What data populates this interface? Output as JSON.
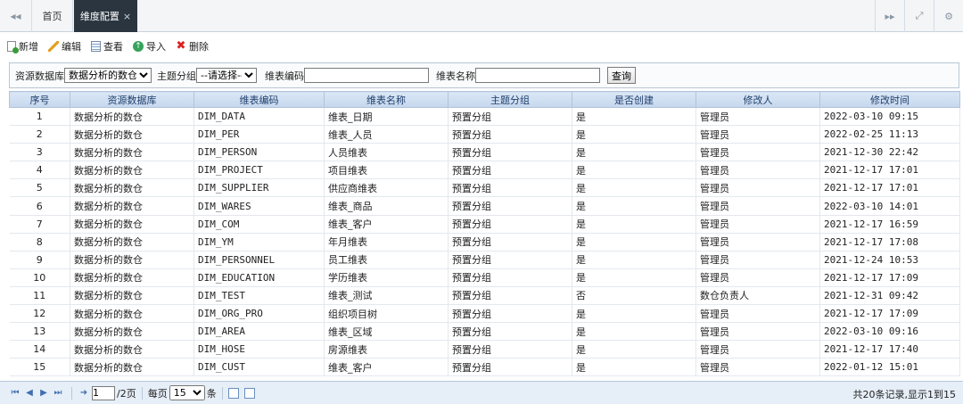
{
  "tabs": {
    "home_label": "首页",
    "active_label": "维度配置",
    "active_close": "×",
    "nav_left": "◂◂",
    "nav_right": "▸▸",
    "fullscreen": "⤢",
    "settings": "⚙"
  },
  "toolbar": {
    "new_label": "新增",
    "edit_label": "编辑",
    "view_label": "查看",
    "import_label": "导入",
    "delete_label": "删除"
  },
  "search": {
    "db_label": "资源数据库",
    "db_value": "数据分析的数仓",
    "topic_label": "主题分组",
    "topic_value": "--请选择--",
    "code_label": "维表编码",
    "code_value": "",
    "name_label": "维表名称",
    "name_value": "",
    "query_label": "查询"
  },
  "columns": [
    "序号",
    "资源数据库",
    "维表编码",
    "维表名称",
    "主题分组",
    "是否创建",
    "修改人",
    "修改时间"
  ],
  "rows": [
    [
      "1",
      "数据分析的数仓",
      "DIM_DATA",
      "维表_日期",
      "预置分组",
      "是",
      "管理员",
      "2022-03-10 09:15"
    ],
    [
      "2",
      "数据分析的数仓",
      "DIM_PER",
      "维表_人员",
      "预置分组",
      "是",
      "管理员",
      "2022-02-25 11:13"
    ],
    [
      "3",
      "数据分析的数仓",
      "DIM_PERSON",
      "人员维表",
      "预置分组",
      "是",
      "管理员",
      "2021-12-30 22:42"
    ],
    [
      "4",
      "数据分析的数仓",
      "DIM_PROJECT",
      "项目维表",
      "预置分组",
      "是",
      "管理员",
      "2021-12-17 17:01"
    ],
    [
      "5",
      "数据分析的数仓",
      "DIM_SUPPLIER",
      "供应商维表",
      "预置分组",
      "是",
      "管理员",
      "2021-12-17 17:01"
    ],
    [
      "6",
      "数据分析的数仓",
      "DIM_WARES",
      "维表_商品",
      "预置分组",
      "是",
      "管理员",
      "2022-03-10 14:01"
    ],
    [
      "7",
      "数据分析的数仓",
      "DIM_COM",
      "维表_客户",
      "预置分组",
      "是",
      "管理员",
      "2021-12-17 16:59"
    ],
    [
      "8",
      "数据分析的数仓",
      "DIM_YM",
      "年月维表",
      "预置分组",
      "是",
      "管理员",
      "2021-12-17 17:08"
    ],
    [
      "9",
      "数据分析的数仓",
      "DIM_PERSONNEL",
      "员工维表",
      "预置分组",
      "是",
      "管理员",
      "2021-12-24 10:53"
    ],
    [
      "10",
      "数据分析的数仓",
      "DIM_EDUCATION",
      "学历维表",
      "预置分组",
      "是",
      "管理员",
      "2021-12-17 17:09"
    ],
    [
      "11",
      "数据分析的数仓",
      "DIM_TEST",
      "维表_测试",
      "预置分组",
      "否",
      "数仓负责人",
      "2021-12-31 09:42"
    ],
    [
      "12",
      "数据分析的数仓",
      "DIM_ORG_PRO",
      "组织项目树",
      "预置分组",
      "是",
      "管理员",
      "2021-12-17 17:09"
    ],
    [
      "13",
      "数据分析的数仓",
      "DIM_AREA",
      "维表_区域",
      "预置分组",
      "是",
      "管理员",
      "2022-03-10 09:16"
    ],
    [
      "14",
      "数据分析的数仓",
      "DIM_HOSE",
      "房源维表",
      "预置分组",
      "是",
      "管理员",
      "2021-12-17 17:40"
    ],
    [
      "15",
      "数据分析的数仓",
      "DIM_CUST",
      "维表_客户",
      "预置分组",
      "是",
      "管理员",
      "2022-01-12 15:01"
    ]
  ],
  "pager": {
    "current_page": "1",
    "total_pages": "/2页",
    "per_page_prefix": "每页",
    "per_page_value": "15",
    "per_page_suffix": "条",
    "summary": "共20条记录,显示1到15"
  }
}
